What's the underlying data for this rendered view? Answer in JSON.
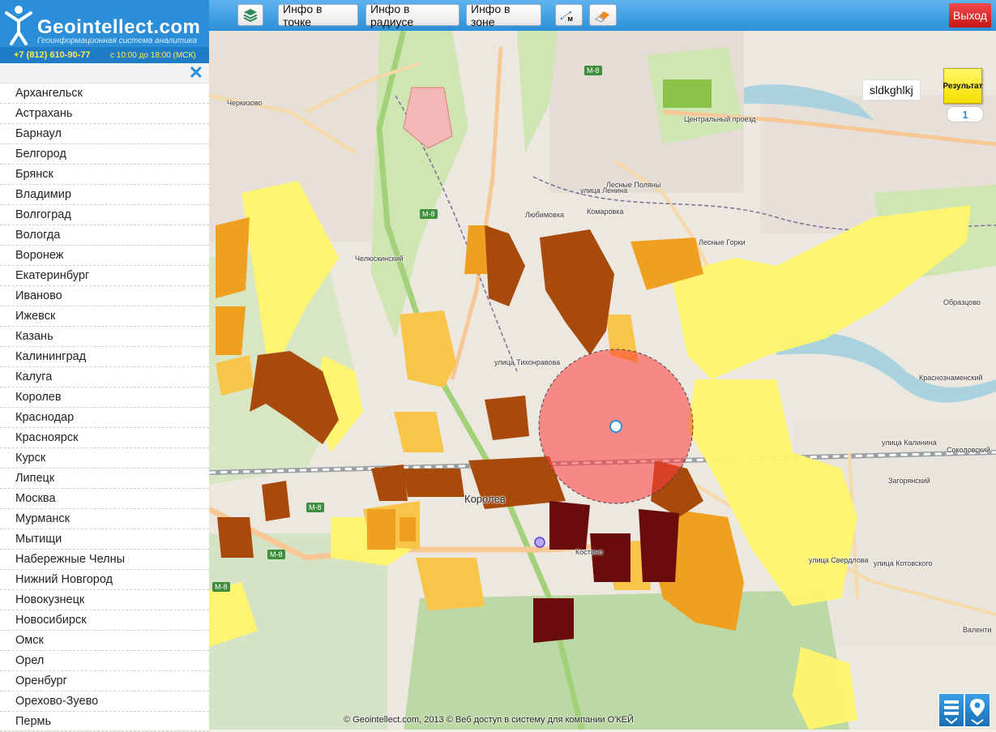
{
  "app": {
    "brand": "Geointellect.com",
    "tagline": "Геоинформационная система аналитика",
    "phone": "+7 (812) 610-90-77",
    "hours": "с 10:00 до 18:00 (МСК)"
  },
  "toolbar": {
    "layers_icon": "layers-icon",
    "info_point": "Инфо в точке",
    "info_radius": "Инфо в радиусе",
    "info_zone": "Инфо в зоне",
    "measure_icon_label": "м",
    "eraser_icon": "eraser-icon",
    "exit": "Выход"
  },
  "sidebar": {
    "cities": [
      "Архангельск",
      "Астрахань",
      "Барнаул",
      "Белгород",
      "Брянск",
      "Владимир",
      "Волгоград",
      "Вологда",
      "Воронеж",
      "Екатеринбург",
      "Иваново",
      "Ижевск",
      "Казань",
      "Калининград",
      "Калуга",
      "Королев",
      "Краснодар",
      "Красноярск",
      "Курск",
      "Липецк",
      "Москва",
      "Мурманск",
      "Мытищи",
      "Набережные Челны",
      "Нижний Новгород",
      "Новокузнецк",
      "Новосибирск",
      "Омск",
      "Орел",
      "Оренбург",
      "Орехово-Зуево",
      "Пермь"
    ]
  },
  "map": {
    "result_label": "Результат",
    "result_count": "1",
    "tooltip": "sldkghlkj",
    "copyright": "© Geointellect.com, 2013 © Веб доступ в систему для компании О'КЕЙ",
    "labels": {
      "cherkizovo": "Черкизово",
      "chelyuskinsky": "Челюскинский",
      "lyubimovka": "Любимовка",
      "komarovka": "Комаровка",
      "lesnye_polyany": "Лесные Поляны",
      "lesnye_gorki": "Лесные Горки",
      "obraztsovo": "Образцово",
      "krasnoznamensky": "Краснознаменский",
      "sokolovsky": "Соколовский",
      "zagoryansky": "Загорянский",
      "korolev": "Королев",
      "kostino": "Костино",
      "valentinovka": "Валенти",
      "tsentralny": "Центральный проезд",
      "ul_lenina": "улица Ленина",
      "ul_tikhonravova": "улица Тихонравова",
      "ul_kalinina": "улица Калинина",
      "ul_sverdlova": "улица Свердлова",
      "ul_kotovskogo": "улица Котовского",
      "m8": "М-8"
    }
  },
  "colors": {
    "topbar": "#2a8fd8",
    "exit": "#d92020",
    "zone_yellow": "#fff56b",
    "zone_light_orange": "#f9c44a",
    "zone_orange": "#f0a020",
    "zone_brown": "#a84a0c",
    "zone_dark": "#6a0c0c",
    "radius": "#ff3b3b"
  }
}
